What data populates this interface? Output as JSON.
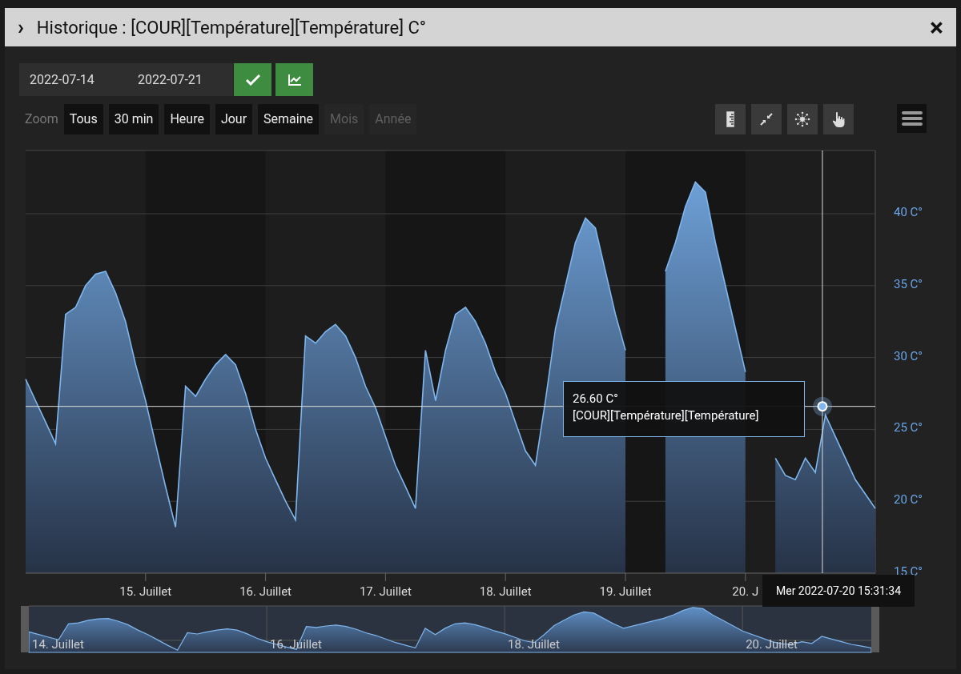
{
  "window": {
    "title": "Historique : [COUR][Température][Température] C°",
    "expand_glyph": "›",
    "close_glyph": "×"
  },
  "date_range": {
    "start": "2022-07-14",
    "end": "2022-07-21"
  },
  "zoom": {
    "label": "Zoom",
    "buttons": [
      {
        "label": "Tous",
        "disabled": false
      },
      {
        "label": "30 min",
        "disabled": false
      },
      {
        "label": "Heure",
        "disabled": false
      },
      {
        "label": "Jour",
        "disabled": false
      },
      {
        "label": "Semaine",
        "disabled": false
      },
      {
        "label": "Mois",
        "disabled": true
      },
      {
        "label": "Année",
        "disabled": true
      }
    ]
  },
  "chart": {
    "chart_data": {
      "type": "area",
      "grid": true,
      "xlim": [
        14,
        21.083
      ],
      "ylim": [
        15,
        44.4
      ],
      "xticks": [
        {
          "value": 15,
          "label": "15. Juillet"
        },
        {
          "value": 16,
          "label": "16. Juillet"
        },
        {
          "value": 17,
          "label": "17. Juillet"
        },
        {
          "value": 18,
          "label": "18. Juillet"
        },
        {
          "value": 19,
          "label": "19. Juillet"
        },
        {
          "value": 20,
          "label": "20. J"
        }
      ],
      "yticks": [
        {
          "value": 15,
          "label": "15 C°"
        },
        {
          "value": 20,
          "label": "20 C°"
        },
        {
          "value": 25,
          "label": "25 C°"
        },
        {
          "value": 30,
          "label": "30 C°"
        },
        {
          "value": 35,
          "label": "35 C°"
        },
        {
          "value": 40,
          "label": "40 C°"
        }
      ],
      "x": [
        14,
        14.083,
        14.167,
        14.25,
        14.333,
        14.417,
        14.5,
        14.583,
        14.667,
        14.75,
        14.833,
        14.917,
        15,
        15.083,
        15.167,
        15.25,
        15.333,
        15.417,
        15.5,
        15.583,
        15.667,
        15.75,
        15.833,
        15.917,
        16,
        16.083,
        16.167,
        16.25,
        16.333,
        16.417,
        16.5,
        16.583,
        16.667,
        16.75,
        16.833,
        16.917,
        17,
        17.083,
        17.167,
        17.25,
        17.333,
        17.417,
        17.5,
        17.583,
        17.667,
        17.75,
        17.833,
        17.917,
        18,
        18.083,
        18.167,
        18.25,
        18.333,
        18.417,
        18.5,
        18.583,
        18.667,
        18.75,
        18.833,
        18.917,
        19,
        19.083,
        19.167,
        19.25,
        19.333,
        19.417,
        19.5,
        19.583,
        19.667,
        19.75,
        19.833,
        19.917,
        20,
        20.083,
        20.167,
        20.25,
        20.333,
        20.417,
        20.5,
        20.583,
        20.667,
        20.75,
        20.833,
        20.917,
        21,
        21.083
      ],
      "series": [
        {
          "name": "[COUR][Température][Température]",
          "color": "#7fb6ee",
          "values": [
            28.5,
            27,
            25.5,
            24,
            33,
            33.5,
            35,
            35.8,
            36,
            34.5,
            32.5,
            29.5,
            27,
            24,
            21,
            18.2,
            28,
            27.3,
            28.5,
            29.5,
            30.2,
            29.5,
            27.5,
            25,
            23,
            21.5,
            20,
            18.7,
            31.5,
            31,
            31.8,
            32.3,
            31.5,
            30,
            28,
            26.5,
            24.5,
            22.5,
            21,
            19.5,
            30.5,
            27,
            30.5,
            33,
            33.5,
            32.5,
            31,
            29,
            27.5,
            25.5,
            23.5,
            22.5,
            27,
            32,
            35,
            38,
            39.7,
            39,
            36,
            33,
            30.5,
            null,
            null,
            null,
            36,
            38,
            40.5,
            42.2,
            41.5,
            38,
            35,
            32,
            29,
            null,
            null,
            23,
            21.8,
            21.5,
            23,
            22,
            26,
            24.5,
            23,
            21.5,
            20.5,
            19.5
          ]
        }
      ],
      "ref_lines": [
        {
          "axis": "x",
          "value": 20.642
        },
        {
          "axis": "y",
          "value": 26.6
        }
      ]
    },
    "tooltip": {
      "value": "26.60 C°",
      "time": "Mer 2022-07-20 15:31:34"
    },
    "navigator": {
      "labels": [
        "14. Juillet",
        "16. Juillet",
        "18. Juillet",
        "20. Juillet"
      ]
    }
  }
}
